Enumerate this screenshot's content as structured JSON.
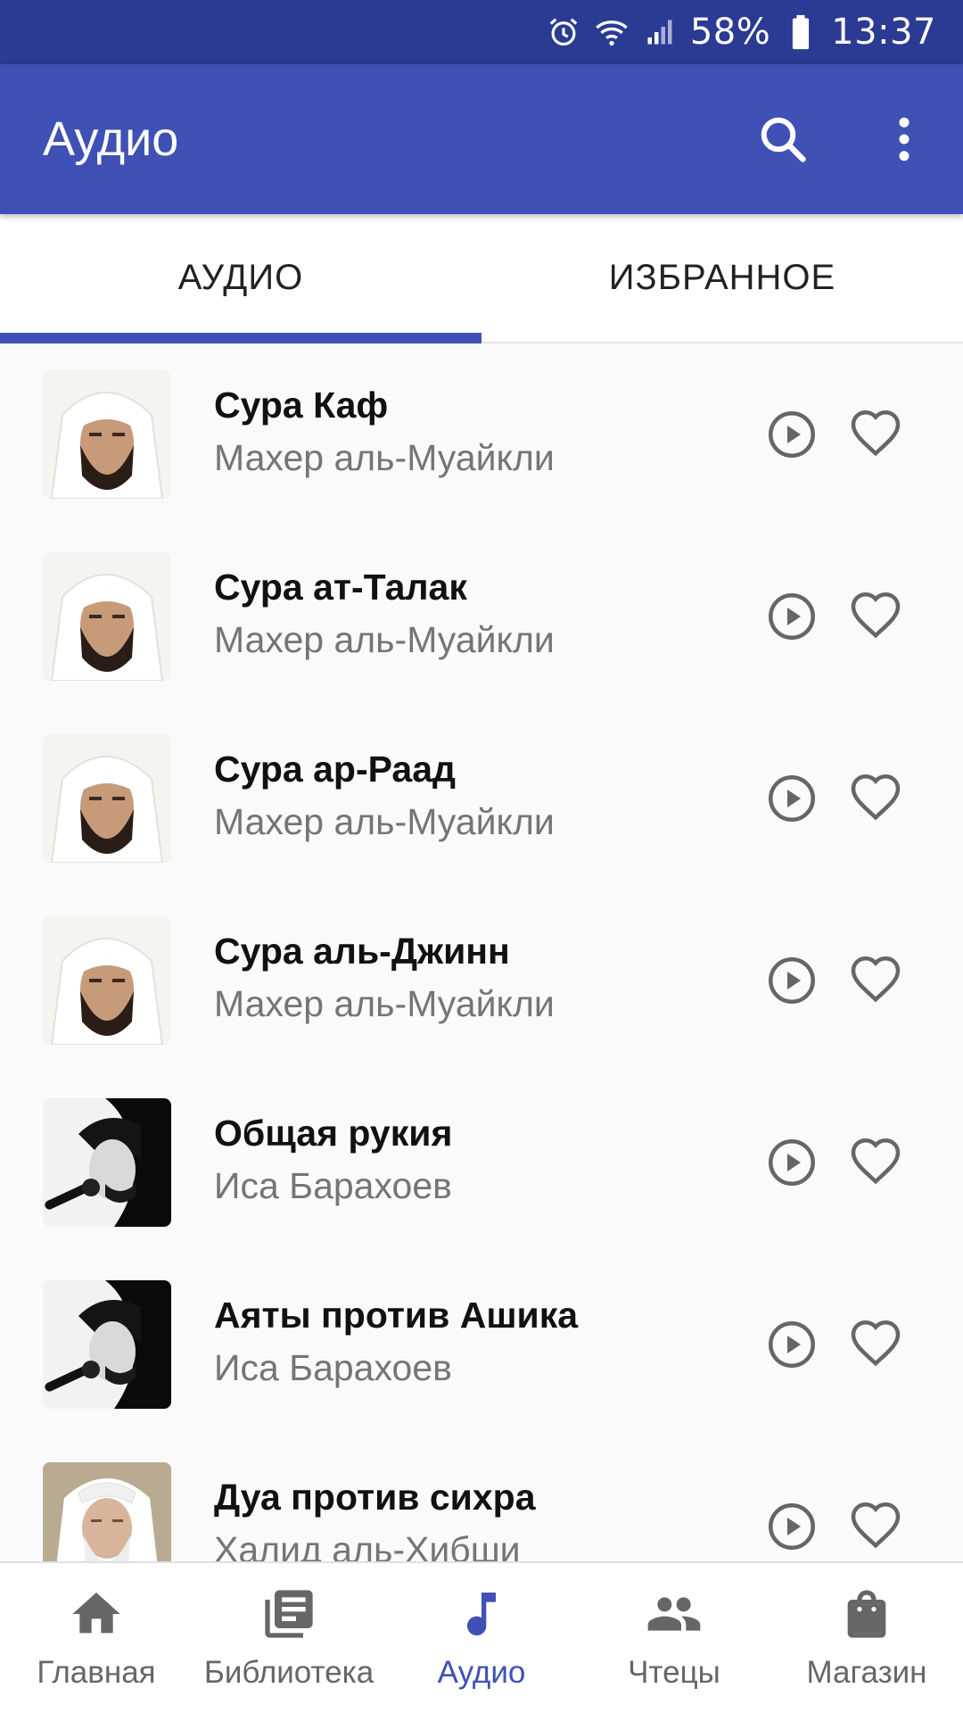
{
  "status_bar": {
    "battery": "58%",
    "time": "13:37",
    "icons": [
      "alarm-icon",
      "wifi-icon",
      "signal-icon",
      "battery-icon"
    ]
  },
  "app_bar": {
    "title": "Аудио",
    "actions": [
      "search-icon",
      "more-vert-icon"
    ]
  },
  "tabs": [
    {
      "label": "АУДИО",
      "active": true
    },
    {
      "label": "ИЗБРАННОЕ",
      "active": false
    }
  ],
  "items": [
    {
      "title": "Сура Каф",
      "reciter": "Махер аль-Муайкли"
    },
    {
      "title": "Сура ат-Талак",
      "reciter": "Махер аль-Муайкли"
    },
    {
      "title": "Сура ар-Раад",
      "reciter": "Махер аль-Муайкли"
    },
    {
      "title": "Сура аль-Джинн",
      "reciter": "Махер аль-Муайкли"
    },
    {
      "title": "Общая рукия",
      "reciter": "Иса Барахоев"
    },
    {
      "title": "Аяты против Ашика",
      "reciter": "Иса Барахоев"
    },
    {
      "title": "Дуа против сихра",
      "reciter": "Халид аль-Хибши"
    }
  ],
  "bottom_nav": [
    {
      "label": "Главная",
      "icon": "home-icon",
      "active": false
    },
    {
      "label": "Библиотека",
      "icon": "library-icon",
      "active": false
    },
    {
      "label": "Аудио",
      "icon": "music-note-icon",
      "active": true
    },
    {
      "label": "Чтецы",
      "icon": "people-icon",
      "active": false
    },
    {
      "label": "Магазин",
      "icon": "shopping-bag-icon",
      "active": false
    }
  ],
  "colors": {
    "primary": "#3f51b5",
    "status_bar": "#2b3a93",
    "icon_gray": "#666666",
    "subtitle_gray": "#757575"
  }
}
